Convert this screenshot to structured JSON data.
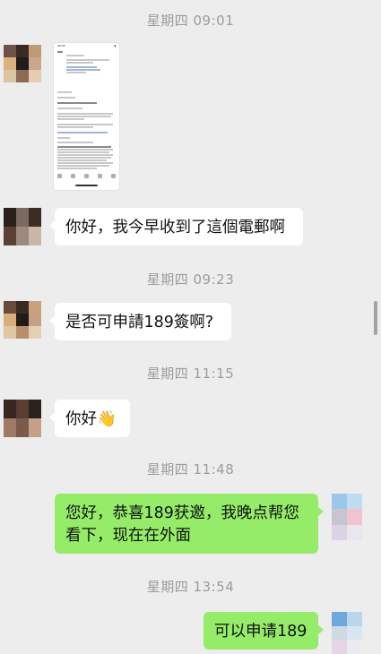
{
  "chat": {
    "timestamps": {
      "t1": "星期四 09:01",
      "t2": "星期四 09:23",
      "t3": "星期四 11:15",
      "t4": "星期四 11:48",
      "t5": "星期四 13:54"
    },
    "messages": {
      "m1_text": "你好，我今早收到了這個電郵啊",
      "m2_text": "是否可申請189簽啊?",
      "m3_text": "你好",
      "m3_emoji": "👋",
      "m4_line1": "您好，恭喜189获邀，我晚点帮您",
      "m4_line2": "看下，现在在外面",
      "m5_text": "可以申请189"
    },
    "image_message": {
      "status_time": "09:00"
    }
  },
  "colors": {
    "background": "#ededed",
    "incoming_bubble": "#ffffff",
    "outgoing_bubble": "#95ec69",
    "timestamp_text": "#9c9c9c"
  },
  "icons": {
    "wave": "waving-hand-emoji"
  }
}
